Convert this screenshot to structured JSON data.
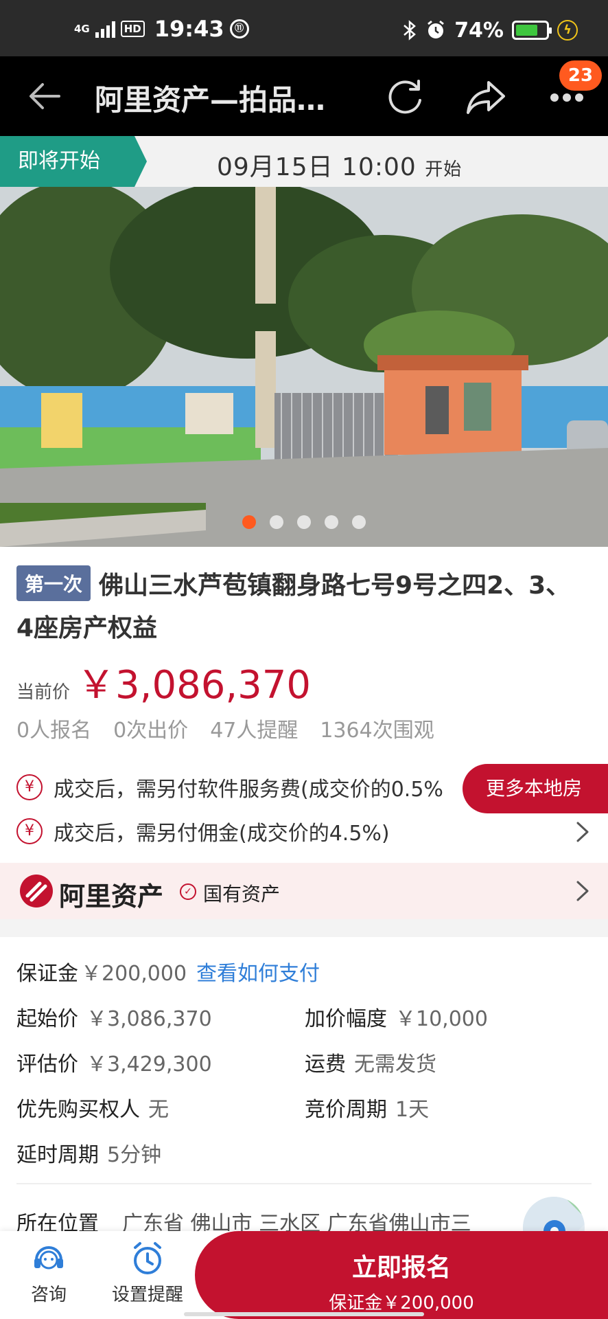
{
  "status_bar": {
    "network": "4G",
    "hd": "HD",
    "time": "19:43",
    "circle_icon_text": "⑪",
    "battery_percent": "74%",
    "battery_level": 0.74
  },
  "nav": {
    "title": "阿里资产—拍品…",
    "badge": "23"
  },
  "auction": {
    "status": "即将开始",
    "time": "09月15日 10:00",
    "time_suffix": "开始"
  },
  "gallery": {
    "total": 5,
    "active_index": 0
  },
  "item": {
    "round": "第一次",
    "title": "佛山三水芦苞镇翻身路七号9号之四2、3、4座房产权益",
    "price_label": "当前价",
    "price": "￥3,086,370",
    "stats": [
      "0人报名",
      "0次出价",
      "47人提醒",
      "1364次围观"
    ]
  },
  "fees": [
    {
      "icon": "¥",
      "text": "成交后，需另付软件服务费(成交价的0.5%"
    },
    {
      "icon": "¥",
      "text": "成交后，需另付佣金(成交价的4.5%)"
    }
  ],
  "more_local_button": "更多本地房",
  "brand": {
    "name": "阿里资产",
    "tag": "国有资产"
  },
  "deposit": {
    "label": "保证金",
    "value": "￥200,000",
    "link": "查看如何支付"
  },
  "details": {
    "start_price_label": "起始价",
    "start_price": "￥3,086,370",
    "increment_label": "加价幅度",
    "increment": "￥10,000",
    "appraisal_label": "评估价",
    "appraisal": "￥3,429,300",
    "shipping_label": "运费",
    "shipping": "无需发货",
    "priority_label": "优先购买权人",
    "priority": "无",
    "cycle_label": "竞价周期",
    "cycle": "1天",
    "delay_label": "延时周期",
    "delay": "5分钟"
  },
  "location": {
    "label": "所在位置",
    "value": "广东省 佛山市 三水区 广东省佛山市三"
  },
  "bottom_bar": {
    "consult": "咨询",
    "reminder": "设置提醒",
    "signup": "立即报名",
    "signup_sub": "保证金￥200,000"
  },
  "colors": {
    "accent_red": "#c3122f",
    "tag_green": "#1f9c86",
    "badge_orange": "#ff5a1f",
    "link_blue": "#2f7ed8"
  }
}
